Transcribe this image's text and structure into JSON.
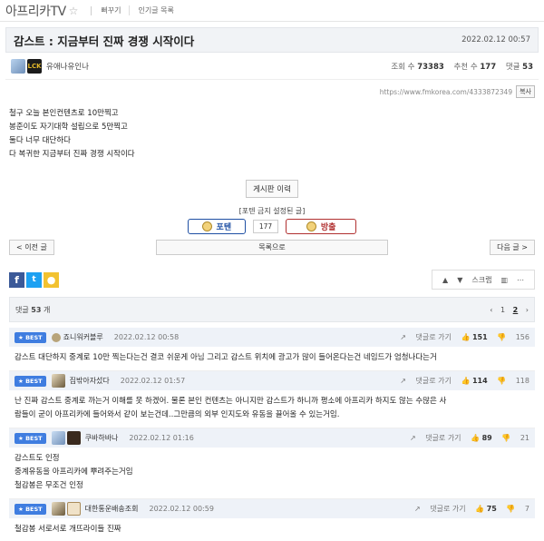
{
  "header": {
    "site": "아프리카TV",
    "links": [
      "뻐꾸기",
      "인기글 목록"
    ]
  },
  "post": {
    "title": "감스트 : 지금부터 진짜 경쟁 시작이다",
    "date": "2022.02.12 00:57",
    "author": "유애나유인나",
    "views_label": "조회 수",
    "views": "73383",
    "recommend_label": "추천 수",
    "recommend": "177",
    "comments_label": "댓글",
    "comments": "53",
    "url": "https://www.fmkorea.com/4333872349",
    "copy_label": "복사",
    "lines": [
      "철구 오늘 본인컨텐츠로 10만찍고",
      "봉준이도 자기대학 설립으로 5만찍고",
      "둘다 너무 대단하다",
      "다 복귀한 지금부터 진짜 경쟁 시작이다"
    ]
  },
  "actions": {
    "history": "게시판 이력",
    "vote_label": "[포텐 금지 설정된 글]",
    "up": "포텐",
    "count": "177",
    "down": "방출",
    "prev": "< 이전 글",
    "list": "목록으로",
    "next": "다음 글 >",
    "scrap": "스크랩"
  },
  "comment_header": {
    "label": "댓글",
    "count": "53",
    "count_suffix": "개",
    "pager": [
      "‹",
      "1",
      "2",
      "›"
    ]
  },
  "comments": [
    {
      "badge": "★ BEST",
      "name": "죠니워커블루",
      "date": "2022.02.12 00:58",
      "reply": "댓글로 가기",
      "up": "151",
      "down": "156",
      "lines": [
        "감스트 대단하지 중계로 10만 찍는다는건 결코 쉬운게 아님 그리고 감스트 위치에 광고가 많이 들어온다는건 네임드가 엄청나다는거"
      ]
    },
    {
      "badge": "★ BEST",
      "name": "집밖아자섰다",
      "date": "2022.02.12 01:57",
      "reply": "댓글로 가기",
      "up": "114",
      "down": "118",
      "lines": [
        "난 진짜 감스트 중계로 까는거 이해를 못 하겠어. 물론 본인 컨텐츠는 아니지만 감스트가 하니까 평소에 아프리카 하지도 않는 수많은 사",
        "람들이 굳이 아프리카에 들어와서 같이 보는건데..그만큼의 외부 인지도와 유동을 끌어올 수 있는거임."
      ]
    },
    {
      "badge": "★ BEST",
      "name": "쿠바하바나",
      "date": "2022.02.12 01:16",
      "reply": "댓글로 가기",
      "up": "89",
      "down": "21",
      "lines": [
        "감스트도 인정",
        "중계유동을 아프리카에 뿌려주는거임",
        "철감봉은 무조건 인정"
      ]
    },
    {
      "badge": "★ BEST",
      "name": "대한통운배송조회",
      "date": "2022.02.12 00:59",
      "reply": "댓글로 가기",
      "up": "75",
      "down": "7",
      "lines": [
        "철감봉 서로서로 개뜨라이들 진짜"
      ]
    }
  ]
}
